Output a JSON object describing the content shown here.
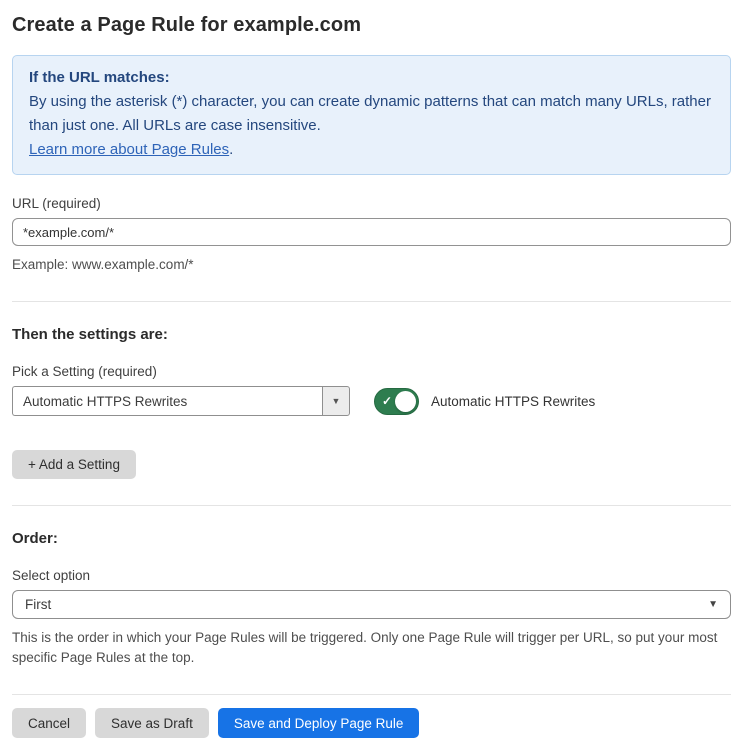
{
  "page": {
    "title": "Create a Page Rule for example.com"
  },
  "info_box": {
    "heading": "If the URL matches:",
    "body": "By using the asterisk (*) character, you can create dynamic patterns that can match many URLs, rather than just one. All URLs are case insensitive.",
    "link_label": "Learn more about Page Rules",
    "link_suffix": "."
  },
  "url_section": {
    "label": "URL (required)",
    "value": "*example.com/*",
    "helper": "Example: www.example.com/*"
  },
  "settings_section": {
    "heading": "Then the settings are:",
    "picker_label": "Pick a Setting (required)",
    "selected_setting": "Automatic HTTPS Rewrites",
    "toggle_state": "on",
    "toggle_label": "Automatic HTTPS Rewrites",
    "add_setting_label": "+ Add a Setting"
  },
  "order_section": {
    "heading": "Order:",
    "select_label": "Select option",
    "selected_option": "First",
    "helper": "This is the order in which your Page Rules will be triggered. Only one Page Rule will trigger per URL, so put your most specific Page Rules at the top."
  },
  "footer": {
    "cancel_label": "Cancel",
    "save_draft_label": "Save as Draft",
    "save_deploy_label": "Save and Deploy Page Rule"
  },
  "icons": {
    "dropdown_arrow": "▼",
    "check": "✓"
  },
  "colors": {
    "accent_blue": "#1773e6",
    "info_bg": "#e8f1fb",
    "info_border": "#b7d4f0",
    "info_text": "#24477e",
    "link_blue": "#2e64b8",
    "toggle_green": "#2e7d4f",
    "button_gray": "#d8d8d8"
  }
}
